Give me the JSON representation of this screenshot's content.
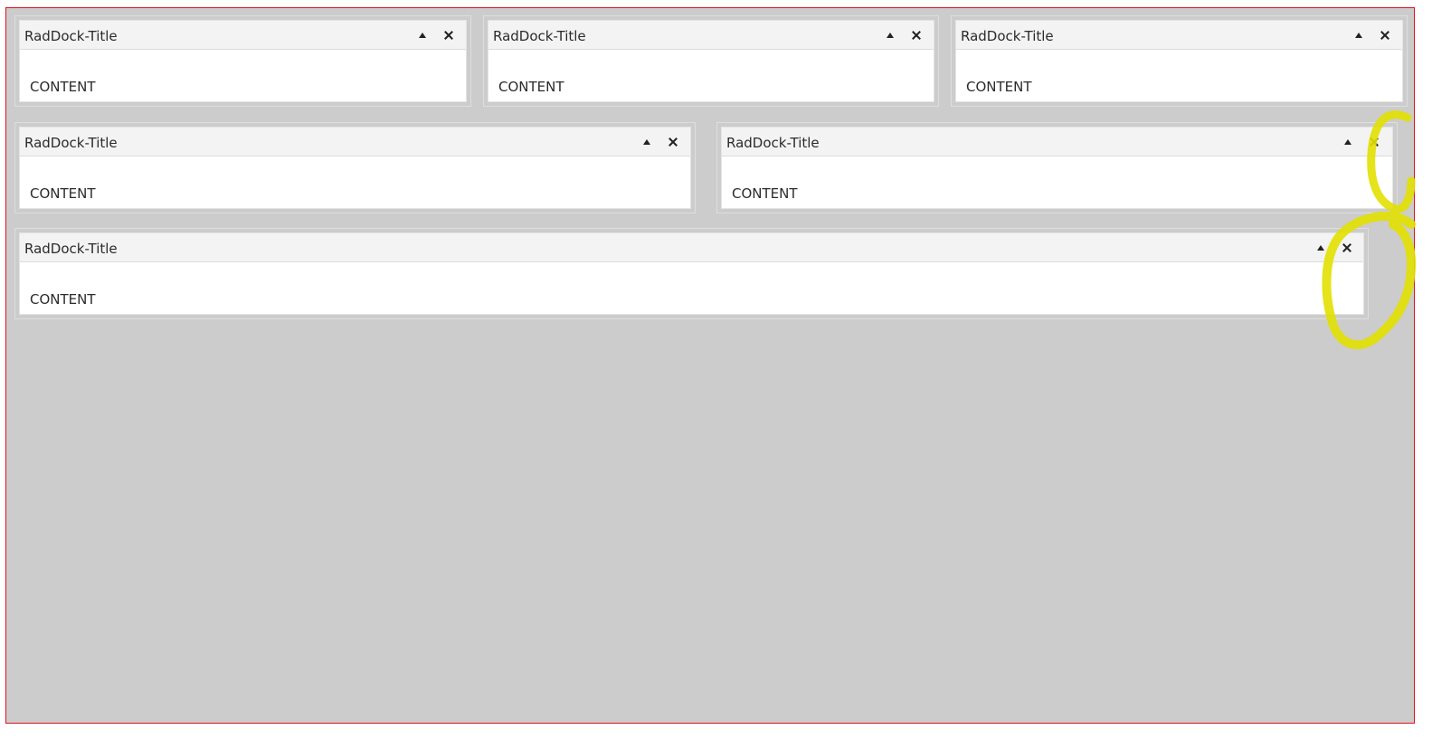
{
  "docks": [
    {
      "title": "RadDock-Title",
      "content": "CONTENT"
    },
    {
      "title": "RadDock-Title",
      "content": "CONTENT"
    },
    {
      "title": "RadDock-Title",
      "content": "CONTENT"
    },
    {
      "title": "RadDock-Title",
      "content": "CONTENT"
    },
    {
      "title": "RadDock-Title",
      "content": "CONTENT"
    },
    {
      "title": "RadDock-Title",
      "content": "CONTENT"
    }
  ],
  "icons": {
    "collapse": "collapse-arrow-up-icon",
    "close": "close-icon"
  },
  "colors": {
    "background": "#cccccc",
    "frame_border": "#e0121c",
    "titlebar": "#f3f3f3",
    "highlight": "#e2e000"
  }
}
